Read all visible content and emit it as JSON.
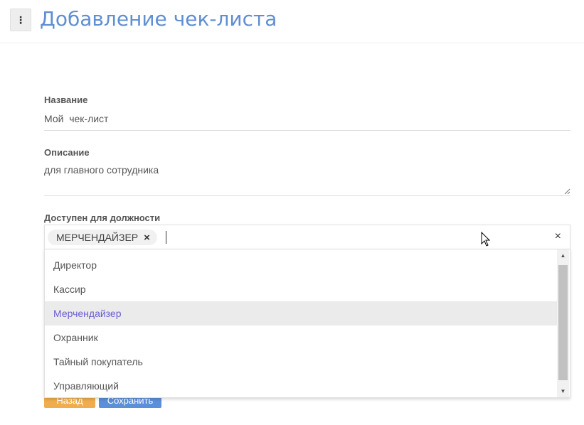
{
  "header": {
    "menu_icon": "vertical-dots-icon",
    "title": "Добавление чек-листа"
  },
  "form": {
    "name": {
      "label": "Название",
      "value": "Мой  чек-лист"
    },
    "description": {
      "label": "Описание",
      "value": "для главного сотрудника"
    },
    "position": {
      "label": "Доступен для должности",
      "selected_tags": [
        "МЕРЧЕНДАЙЗЕР"
      ],
      "tag_remove": "×",
      "clear": "×",
      "options": [
        "Директор",
        "Кассир",
        "Мерчендайзер",
        "Охранник",
        "Тайный покупатель",
        "Управляющий"
      ],
      "highlighted_option": "Мерчендайзер"
    }
  },
  "actions": {
    "back_label": "Назад",
    "save_label": "Сохранить"
  },
  "colors": {
    "title": "#5f8ed1",
    "highlight_text": "#6a5fd0",
    "back_button": "#f0ad4e",
    "save_button": "#5b8fd9"
  }
}
